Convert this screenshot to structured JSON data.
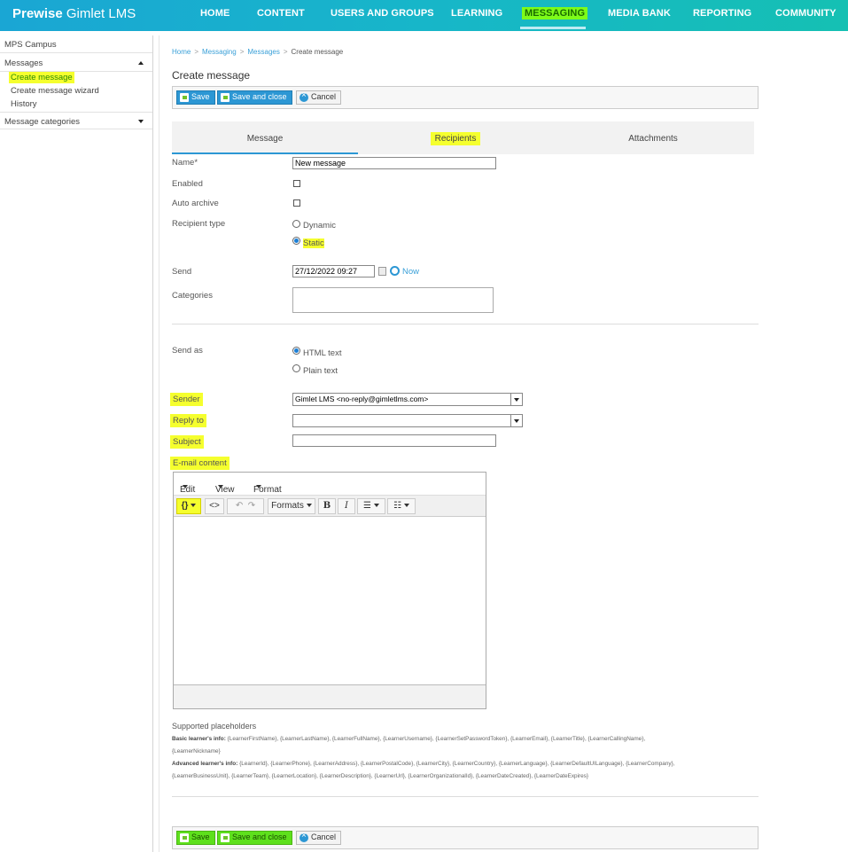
{
  "brand": {
    "bold": "Prewise",
    "rest": "Gimlet LMS"
  },
  "nav": [
    "HOME",
    "CONTENT",
    "USERS AND GROUPS",
    "LEARNING",
    "MESSAGING",
    "MEDIA BANK",
    "REPORTING",
    "COMMUNITY"
  ],
  "sidebar": {
    "campus": "MPS Campus",
    "messages": "Messages",
    "items": [
      "Create message",
      "Create message wizard",
      "History"
    ],
    "categories": "Message categories"
  },
  "breadcrumb": [
    "Home",
    "Messaging",
    "Messages",
    "Create message"
  ],
  "page_title": "Create message",
  "toolbar": {
    "save": "Save",
    "save_close": "Save and close",
    "cancel": "Cancel"
  },
  "tabs": [
    "Message",
    "Recipients",
    "Attachments"
  ],
  "form": {
    "name_label": "Name*",
    "name_value": "New message",
    "enabled_label": "Enabled",
    "auto_archive_label": "Auto archive",
    "recipient_type_label": "Recipient type",
    "recipient_dynamic": "Dynamic",
    "recipient_static": "Static",
    "send_label": "Send",
    "send_value": "27/12/2022 09:27",
    "now_link": "Now",
    "categories_label": "Categories",
    "send_as_label": "Send as",
    "html_text": "HTML text",
    "plain_text": "Plain text",
    "sender_label": "Sender",
    "sender_value": "Gimlet LMS <no-reply@gimletlms.com>",
    "reply_to_label": "Reply to",
    "reply_to_value": "",
    "subject_label": "Subject",
    "subject_value": "",
    "email_content_label": "E-mail content"
  },
  "editor": {
    "menus": [
      "Edit",
      "View",
      "Format"
    ],
    "placeholder_btn": "{}",
    "code_btn": "<>",
    "formats_btn": "Formats",
    "bold_btn": "B",
    "italic_btn": "I"
  },
  "placeholders": {
    "title": "Supported placeholders",
    "basic_label": "Basic learner's info:",
    "basic_line1": "{LearnerFirstName}, {LearnerLastName}, {LearnerFullName}, {LearnerUsername}, {LearnerSetPasswordToken}, {LearnerEmail}, {LearnerTitle}, {LearnerCallingName},",
    "basic_line2": "{LearnerNickname}",
    "advanced_label": "Advanced learner's info:",
    "advanced_line1": "{LearnerId}, {LearnerPhone}, {LearnerAddress}, {LearnerPostalCode}, {LearnerCity}, {LearnerCountry}, {LearnerLanguage}, {LearnerDefaultUILanguage}, {LearnerCompany},",
    "advanced_line2": "{LearnerBusinessUnit}, {LearnerTeam}, {LearnerLocation}, {LearnerDescription}, {LearnerUrl}, {LearnerOrganizationalId}, {LearnerDateCreated}, {LearnerDateExpires}"
  },
  "colors": {
    "accent": "#2c97d4",
    "highlight": "#f5ff2e",
    "active_nav": "#7dfb1a"
  }
}
